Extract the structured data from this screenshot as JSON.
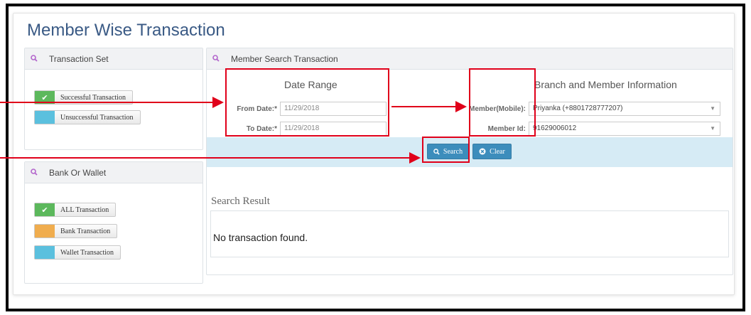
{
  "page": {
    "title": "Member Wise Transaction"
  },
  "transaction_set": {
    "header": "Transaction Set",
    "items": [
      {
        "label": "Successful Transaction",
        "color": "#5cb85c",
        "icon": "✔"
      },
      {
        "label": "Unsuccessful Transaction",
        "color": "#5bc0de",
        "icon": ""
      }
    ]
  },
  "bank_or_wallet": {
    "header": "Bank Or Wallet",
    "items": [
      {
        "label": "ALL Transaction",
        "color": "#5cb85c",
        "icon": "✔"
      },
      {
        "label": "Bank Transaction",
        "color": "#f0ad4e",
        "icon": ""
      },
      {
        "label": "Wallet Transaction",
        "color": "#5bc0de",
        "icon": ""
      }
    ]
  },
  "search": {
    "header": "Member Search Transaction",
    "date_range": {
      "title": "Date Range",
      "from_label": "From Date:*",
      "from_value": "11/29/2018",
      "to_label": "To Date:*",
      "to_value": "11/29/2018"
    },
    "branch": {
      "title": "Branch and Member Information",
      "member_mobile_label": "Member(Mobile):",
      "member_mobile_value": "Priyanka (+8801728777207)",
      "member_id_label": "Member Id:",
      "member_id_value": "91629006012"
    },
    "search_button": "Search",
    "clear_button": "Clear"
  },
  "result": {
    "title": "Search Result",
    "message": "No transaction found."
  },
  "colors": {
    "primary": "#3c8dbc",
    "annotation": "#e0001a",
    "title": "#3a5a85"
  }
}
